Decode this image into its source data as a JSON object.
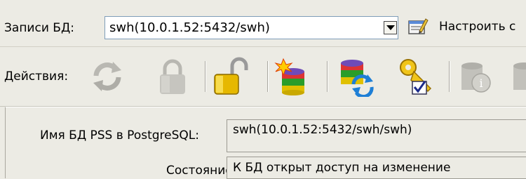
{
  "records": {
    "label": "Записи БД:",
    "selected": "swh(10.0.1.52:5432/swh)",
    "configure_label": "Настроить с"
  },
  "actions": {
    "label": "Действия:",
    "buttons": [
      {
        "icon": "refresh-icon",
        "enabled": false
      },
      {
        "icon": "lock-icon",
        "enabled": false
      },
      {
        "icon": "unlock-icon",
        "enabled": true
      },
      {
        "icon": "database-new-icon",
        "enabled": true
      },
      {
        "icon": "database-sync-icon",
        "enabled": true
      },
      {
        "icon": "key-check-icon",
        "enabled": true
      },
      {
        "icon": "database-info-icon",
        "enabled": false
      },
      {
        "icon": "database-icon",
        "enabled": false
      }
    ]
  },
  "details": {
    "db_name_label": "Имя БД PSS в PostgreSQL:",
    "db_name_value": "swh(10.0.1.52:5432/swh/swh)",
    "state_label": "Состояние:",
    "state_value": "К БД открыт доступ на изменение"
  },
  "colors": {
    "background": "#ecebe4",
    "accent": "#7f9db9"
  }
}
